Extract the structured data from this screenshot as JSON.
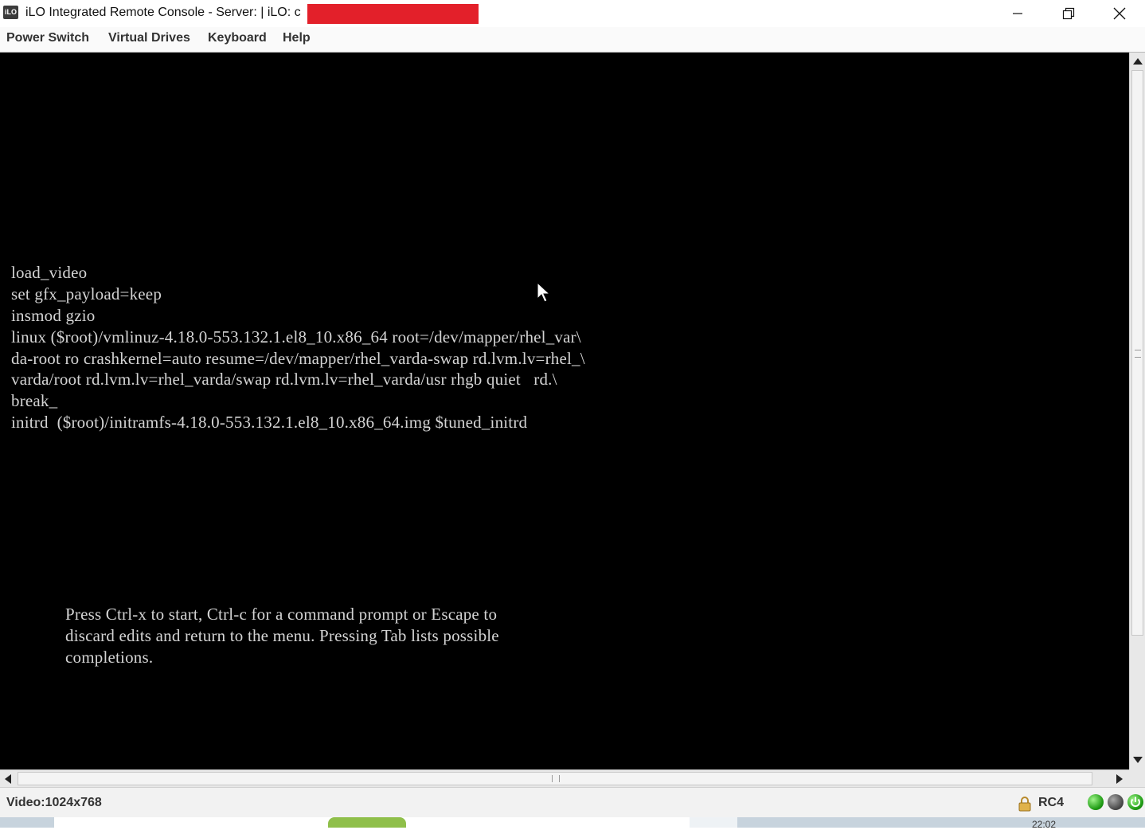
{
  "window": {
    "icon_text": "iLO",
    "title": "iLO Integrated Remote Console - Server:  | iLO: c",
    "controls": [
      "minimize-icon",
      "restore-icon",
      "close-icon"
    ]
  },
  "menu": {
    "items": [
      {
        "label": "Power Switch"
      },
      {
        "label": "Virtual Drives"
      },
      {
        "label": "Keyboard"
      },
      {
        "label": "Help"
      }
    ]
  },
  "console": {
    "lines": [
      "load_video",
      "set gfx_payload=keep",
      "insmod gzio",
      "linux ($root)/vmlinuz-4.18.0-553.132.1.el8_10.x86_64 root=/dev/mapper/rhel_var\\",
      "da-root ro crashkernel=auto resume=/dev/mapper/rhel_varda-swap rd.lvm.lv=rhel_\\",
      "varda/root rd.lvm.lv=rhel_varda/swap rd.lvm.lv=rhel_varda/usr rhgb quiet   rd.\\",
      "break_",
      "initrd  ($root)/initramfs-4.18.0-553.132.1.el8_10.x86_64.img $tuned_initrd"
    ],
    "hint": [
      "Press Ctrl-x to start, Ctrl-c for a command prompt or Escape to",
      "discard edits and return to the menu. Pressing Tab lists possible",
      "completions."
    ],
    "background": "#000000",
    "text_color": "#d4d4d4"
  },
  "status": {
    "video": "Video:1024x768",
    "encryption": "RC4",
    "indicators": [
      {
        "icon": "status-green-icon",
        "color": "#1f9b14"
      },
      {
        "icon": "status-gray-icon",
        "color": "#4a4a4a"
      },
      {
        "icon": "power-icon",
        "color": "#1f9b14"
      }
    ]
  },
  "taskbar": {
    "time_partial": "22:02"
  },
  "colors": {
    "redaction": "#e3202a"
  }
}
